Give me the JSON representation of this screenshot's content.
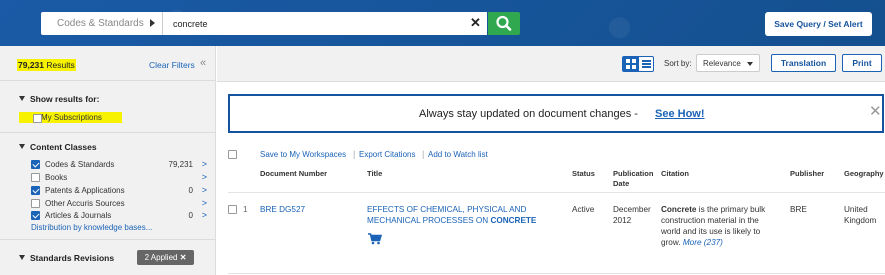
{
  "header": {
    "scope_label": "Codes & Standards",
    "search_value": "concrete",
    "save_query_label": "Save Query / Set Alert"
  },
  "sidebar": {
    "results_count": "79,231",
    "results_suffix": " Results",
    "clear_filters": "Clear Filters",
    "show_results_title": "Show results for:",
    "my_subscriptions": "My Subscriptions",
    "content_classes_title": "Content Classes",
    "content_classes": [
      {
        "label": "Codes & Standards",
        "count": "79,231",
        "checked": true
      },
      {
        "label": "Books",
        "count": "",
        "checked": false
      },
      {
        "label": "Patents & Applications",
        "count": "0",
        "checked": true
      },
      {
        "label": "Other Accuris Sources",
        "count": "",
        "checked": false
      },
      {
        "label": "Articles & Journals",
        "count": "0",
        "checked": true
      }
    ],
    "distribution_link": "Distribution by knowledge bases...",
    "standards_revisions_title": "Standards Revisions",
    "applied_badge": "2 Applied"
  },
  "toolbar": {
    "sort_by_label": "Sort by:",
    "sort_value": "Relevance",
    "translation_label": "Translation",
    "print_label": "Print"
  },
  "banner": {
    "text": "Always stay updated on document changes -",
    "link": "See How!"
  },
  "actions": {
    "save_workspaces": "Save to My Workspaces",
    "export_citations": "Export Citations",
    "add_watch": "Add to Watch list"
  },
  "table": {
    "headers": {
      "doc_number": "Document Number",
      "title": "Title",
      "status": "Status",
      "pub_date_1": "Publication",
      "pub_date_2": "Date",
      "citation": "Citation",
      "publisher": "Publisher",
      "geography": "Geography"
    },
    "rows": [
      {
        "index": "1",
        "doc_number": "BRE DG527",
        "title_1": "EFFECTS OF CHEMICAL, PHYSICAL AND",
        "title_2a": "MECHANICAL PROCESSES ON ",
        "title_2b": "CONCRETE",
        "status": "Active",
        "pub_month": "December",
        "pub_year": "2012",
        "citation_bold": "Concrete",
        "citation_1": " is the primary bulk",
        "citation_2": "construction material in the",
        "citation_3": "world and its use is likely to",
        "citation_4": "grow.",
        "citation_more": "More (237)",
        "publisher": "BRE",
        "geo_1": "United",
        "geo_2": "Kingdom"
      }
    ]
  }
}
